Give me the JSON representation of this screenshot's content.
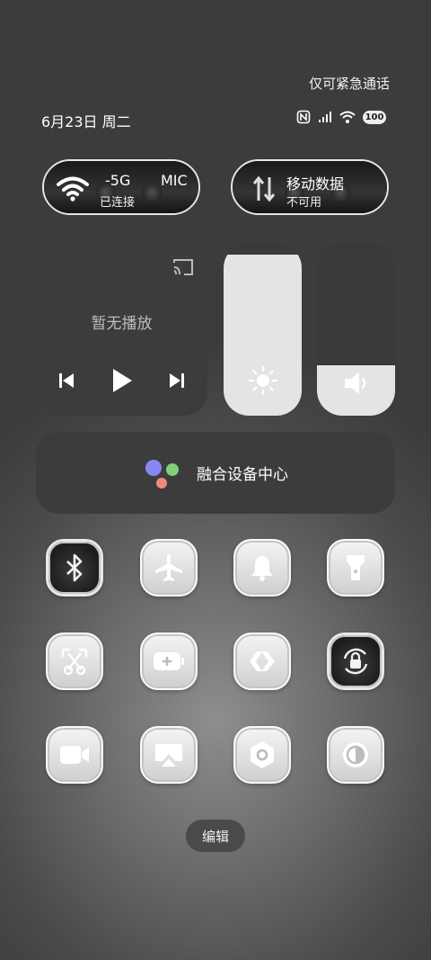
{
  "status": {
    "emergency_text": "仅可紧急通话",
    "date_text": "6月23日 周二",
    "battery_level": "100"
  },
  "wifi_pill": {
    "network_name": "-5G",
    "network_suffix": "MIC",
    "status": "已连接",
    "icon": "wifi-icon"
  },
  "mobile_pill": {
    "title": "移动数据",
    "status": "不可用",
    "icon": "mobile-data-icon"
  },
  "media": {
    "no_playback": "暂无播放",
    "icons": [
      "cast-icon",
      "previous-icon",
      "play-icon",
      "next-icon"
    ]
  },
  "brightness": {
    "level": 0.93,
    "icon": "sun-icon"
  },
  "volume": {
    "level": 0.29,
    "icon": "speaker-icon"
  },
  "fusion": {
    "label": "融合设备中心"
  },
  "toggles": [
    {
      "name": "bluetooth",
      "icon": "bluetooth-icon",
      "active": true
    },
    {
      "name": "airplane-mode",
      "icon": "airplane-icon",
      "active": false
    },
    {
      "name": "silent-mode",
      "icon": "bell-icon",
      "active": false
    },
    {
      "name": "flashlight",
      "icon": "flashlight-icon",
      "active": false
    },
    {
      "name": "screenshot",
      "icon": "scissors-icon",
      "active": false
    },
    {
      "name": "battery-saver",
      "icon": "battery-icon",
      "active": false
    },
    {
      "name": "nearby-share",
      "icon": "share-icon",
      "active": false
    },
    {
      "name": "rotation-lock",
      "icon": "rotation-lock-icon",
      "active": true
    },
    {
      "name": "screen-record",
      "icon": "video-icon",
      "active": false
    },
    {
      "name": "cast-screen",
      "icon": "screencast-icon",
      "active": false
    },
    {
      "name": "settings",
      "icon": "hex-gear-icon",
      "active": false
    },
    {
      "name": "dark-mode",
      "icon": "contrast-icon",
      "active": false
    }
  ],
  "edit_label": "编辑"
}
